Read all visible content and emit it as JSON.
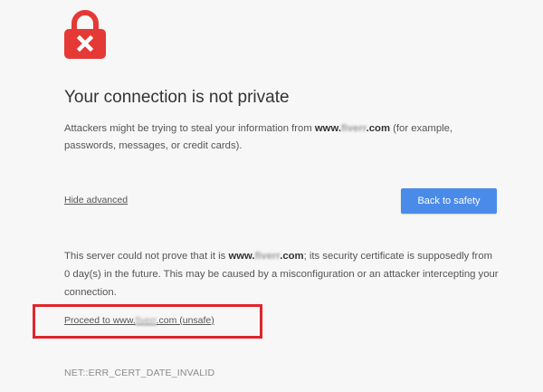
{
  "colors": {
    "background": "#f7f7f7",
    "lock": "#e53935",
    "button": "#4a8bea",
    "highlight": "#e0242b"
  },
  "icon": "lock-error-icon",
  "title": "Your connection is not private",
  "description": {
    "prefix": "Attackers might be trying to steal your information from ",
    "domain": "www.fiverr.com",
    "suffix": " (for example, passwords, messages, or credit cards)."
  },
  "hide_advanced_label": "Hide advanced",
  "back_button_label": "Back to safety",
  "detail": {
    "prefix": "This server could not prove that it is ",
    "domain": "www.fiverr.com",
    "suffix": "; its security certificate is supposedly from 0 day(s) in the future. This may be caused by a misconfiguration or an attacker intercepting your connection."
  },
  "proceed_link": {
    "prefix": "Proceed to www.",
    "blurred": "fiverr",
    "suffix": ".com (unsafe)"
  },
  "error_code": "NET::ERR_CERT_DATE_INVALID"
}
